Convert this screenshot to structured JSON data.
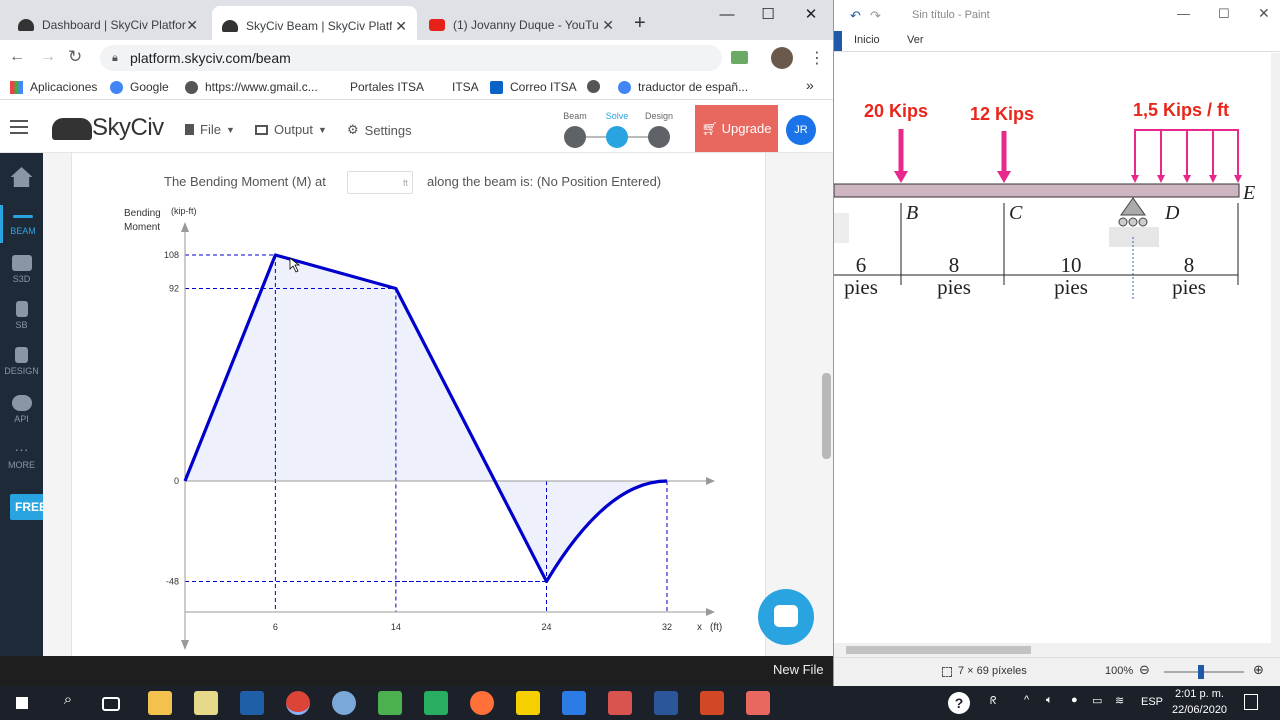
{
  "browser": {
    "tabs": [
      {
        "title": "Dashboard | SkyCiv Platform",
        "active": false
      },
      {
        "title": "SkyCiv Beam | SkyCiv Platform",
        "active": true
      },
      {
        "title": "(1) Jovanny Duque - YouTube",
        "active": false
      }
    ],
    "new_tab": "+",
    "url": "platform.skyciv.com/beam",
    "bookmarks": [
      "Aplicaciones",
      "Google",
      "https://www.gmail.c...",
      "Portales ITSA",
      "ITSA",
      "Correo ITSA",
      "traductor de españ..."
    ],
    "bookmarks_more": "»"
  },
  "skyciv": {
    "logo": "SkyCiv",
    "menu": {
      "file": "File",
      "output": "Output",
      "settings": "Settings"
    },
    "steps": [
      "Beam",
      "Solve",
      "Design"
    ],
    "upgrade": "Upgrade",
    "avatar": "JR",
    "sidebar": [
      {
        "label": "",
        "icon": "home-icon"
      },
      {
        "label": "BEAM",
        "icon": "beam-icon"
      },
      {
        "label": "S3D",
        "icon": "cube-icon"
      },
      {
        "label": "SB",
        "icon": "section-icon"
      },
      {
        "label": "DESIGN",
        "icon": "document-icon"
      },
      {
        "label": "API",
        "icon": "cloud-icon"
      },
      {
        "label": "MORE",
        "icon": "more-icon"
      }
    ],
    "free_badge": "FREE",
    "bm_prefix": "The Bending Moment (M) at",
    "bm_unit": "ft",
    "bm_suffix": "along the beam is: (No Position Entered)",
    "new_file": "New File"
  },
  "chart_data": {
    "type": "line",
    "ylabel": "Bending Moment",
    "yunit": "(kip-ft)",
    "xlabel": "x",
    "xunit": "(ft)",
    "y_ticks": [
      108,
      92,
      0,
      -48
    ],
    "x_ticks": [
      6,
      14,
      24,
      32
    ],
    "points": [
      [
        0,
        0
      ],
      [
        6,
        108
      ],
      [
        14,
        92
      ],
      [
        24,
        -48
      ],
      [
        32,
        0
      ]
    ],
    "segments": [
      {
        "from": [
          0,
          0
        ],
        "to": [
          6,
          108
        ],
        "shape": "linear"
      },
      {
        "from": [
          6,
          108
        ],
        "to": [
          14,
          92
        ],
        "shape": "linear"
      },
      {
        "from": [
          14,
          92
        ],
        "to": [
          24,
          -48
        ],
        "shape": "linear"
      },
      {
        "from": [
          24,
          -48
        ],
        "to": [
          32,
          0
        ],
        "shape": "parabolic"
      }
    ],
    "xlim": [
      0,
      32
    ],
    "ylim": [
      -48,
      108
    ],
    "line_color": "#0000cc",
    "fill_color": "#eef0fb"
  },
  "paint": {
    "title": "Sin título - Paint",
    "ribbon": [
      "Inicio",
      "Ver"
    ],
    "loads": [
      "20 Kips",
      "12 Kips",
      "1,5 Kips / ft"
    ],
    "points": [
      "B",
      "C",
      "D",
      "E"
    ],
    "dims": [
      {
        "value": "6",
        "unit": "pies"
      },
      {
        "value": "8",
        "unit": "pies"
      },
      {
        "value": "10",
        "unit": "pies"
      },
      {
        "value": "8",
        "unit": "pies"
      }
    ],
    "selection_size": "7 × 69 píxeles",
    "zoom": "100%"
  },
  "taskbar": {
    "lang": "ESP",
    "time": "2:01 p. m.",
    "date": "22/06/2020"
  }
}
